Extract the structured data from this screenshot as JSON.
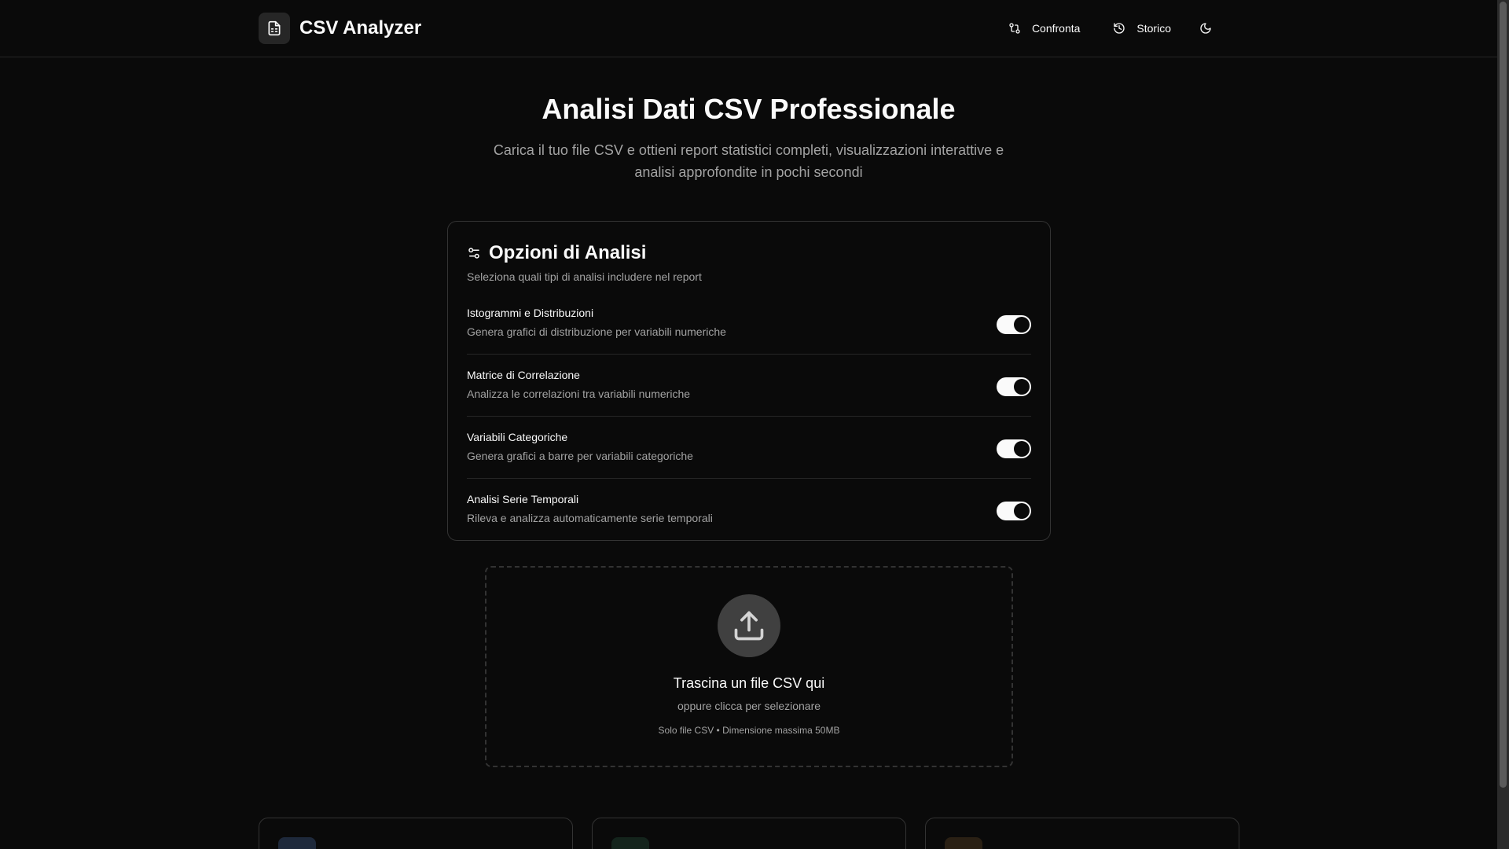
{
  "header": {
    "title": "CSV Analyzer",
    "brand_icon": "file-spreadsheet-icon",
    "nav": [
      {
        "label": "Confronta",
        "icon": "git-compare-icon"
      },
      {
        "label": "Storico",
        "icon": "history-icon"
      }
    ],
    "theme_icon": "moon-icon"
  },
  "hero": {
    "title": "Analisi Dati CSV Professionale",
    "subtitle": "Carica il tuo file CSV e ottieni report statistici completi, visualizzazioni interattive e analisi approfondite in pochi secondi"
  },
  "options": {
    "title": "Opzioni di Analisi",
    "subtitle": "Seleziona quali tipi di analisi includere nel report",
    "items": [
      {
        "label": "Istogrammi e Distribuzioni",
        "desc": "Genera grafici di distribuzione per variabili numeriche",
        "enabled": true
      },
      {
        "label": "Matrice di Correlazione",
        "desc": "Analizza le correlazioni tra variabili numeriche",
        "enabled": true
      },
      {
        "label": "Variabili Categoriche",
        "desc": "Genera grafici a barre per variabili categoriche",
        "enabled": true
      },
      {
        "label": "Analisi Serie Temporali",
        "desc": "Rileva e analizza automaticamente serie temporali",
        "enabled": true
      }
    ]
  },
  "dropzone": {
    "title": "Trascina un file CSV qui",
    "subtitle": "oppure clicca per selezionare",
    "note": "Solo file CSV • Dimensione massima 50MB",
    "icon": "upload-icon"
  },
  "features": [
    {
      "icon_color": "#1e293b"
    },
    {
      "icon_color": "#14241c"
    },
    {
      "icon_color": "#2a2014"
    }
  ],
  "colors": {
    "background": "#0a0a0a",
    "foreground": "#fafafa",
    "muted": "#a3a3a3",
    "border": "#333333"
  }
}
